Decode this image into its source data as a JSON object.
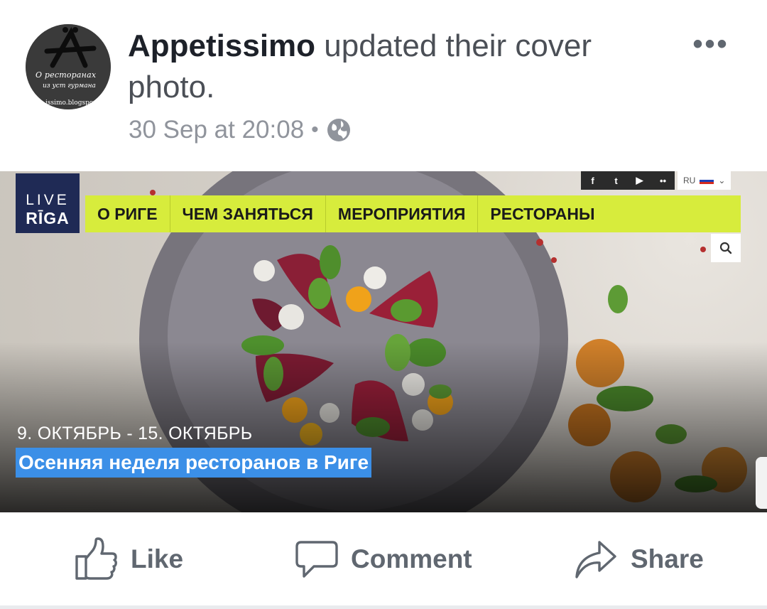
{
  "post": {
    "page_name": "Appetissimo",
    "action_text": "updated their cover photo.",
    "timestamp": "30 Sep at 20:08",
    "separator": "•",
    "privacy_icon": "globe-icon",
    "more_label": "•••",
    "avatar": {
      "script_line1": "О ресторанах",
      "script_line2": "из уст гурмана",
      "url_fragment": "issimo.blogspo"
    }
  },
  "cover": {
    "logo": {
      "line1": "LIVE",
      "line2": "RĪGA"
    },
    "nav": [
      "О РИГЕ",
      "ЧЕМ ЗАНЯТЬСЯ",
      "МЕРОПРИЯТИЯ",
      "РЕСТОРАНЫ"
    ],
    "social": [
      "f",
      "t",
      "▶",
      "••"
    ],
    "language": "RU",
    "search_icon": "search-icon",
    "date_range": "9. ОКТЯБРЬ - 15. ОКТЯБРЬ",
    "event_title": "Осенняя неделя ресторанов в Риге",
    "colors": {
      "nav_bg": "#d7ec3c",
      "logo_bg": "#1f2a55",
      "title_bg": "#3b8fe7"
    }
  },
  "actions": {
    "like": "Like",
    "comment": "Comment",
    "share": "Share"
  }
}
